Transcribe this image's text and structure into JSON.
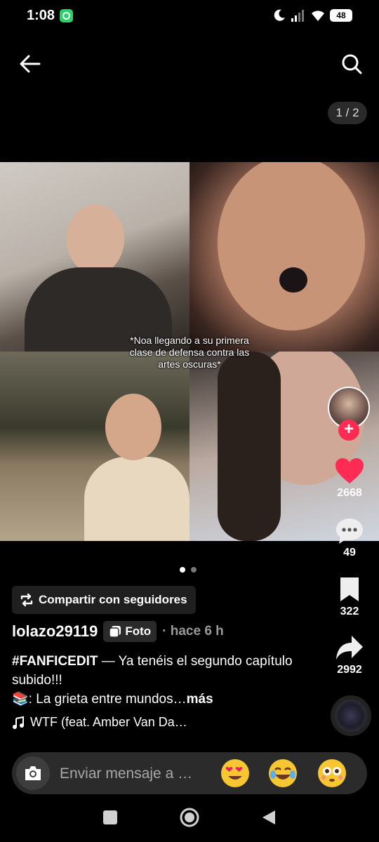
{
  "status_bar": {
    "time": "1:08",
    "battery": "48"
  },
  "header": {
    "page_indicator": "1 / 2"
  },
  "post": {
    "overlay_caption": "*Noa llegando a su primera clase de defensa contra las artes oscuras*",
    "share_label": "Compartir con seguidores",
    "username": "lolazo29119",
    "type_badge": "Foto",
    "time_ago": "· hace 6 h",
    "hashtag": "#FANFICEDIT",
    "description_text": " — Ya tenéis el segundo capítulo subido!!!",
    "description_line2": "📚: La grieta entre mundos…",
    "more_label": "más",
    "music": "WTF (feat. Amber Van Da…"
  },
  "actions": {
    "likes": "2668",
    "comments": "49",
    "saves": "322",
    "shares": "2992"
  },
  "message_bar": {
    "placeholder": "Enviar mensaje a …"
  },
  "colors": {
    "like": "#fe2c55",
    "background": "#000000"
  },
  "icons": [
    "back-arrow-icon",
    "search-icon",
    "plus-icon",
    "heart-icon",
    "comment-icon",
    "bookmark-icon",
    "share-arrow-icon",
    "repost-icon",
    "photo-icon",
    "music-note-icon",
    "camera-icon",
    "heart-eyes-emoji",
    "tears-of-joy-emoji",
    "flushed-emoji"
  ]
}
